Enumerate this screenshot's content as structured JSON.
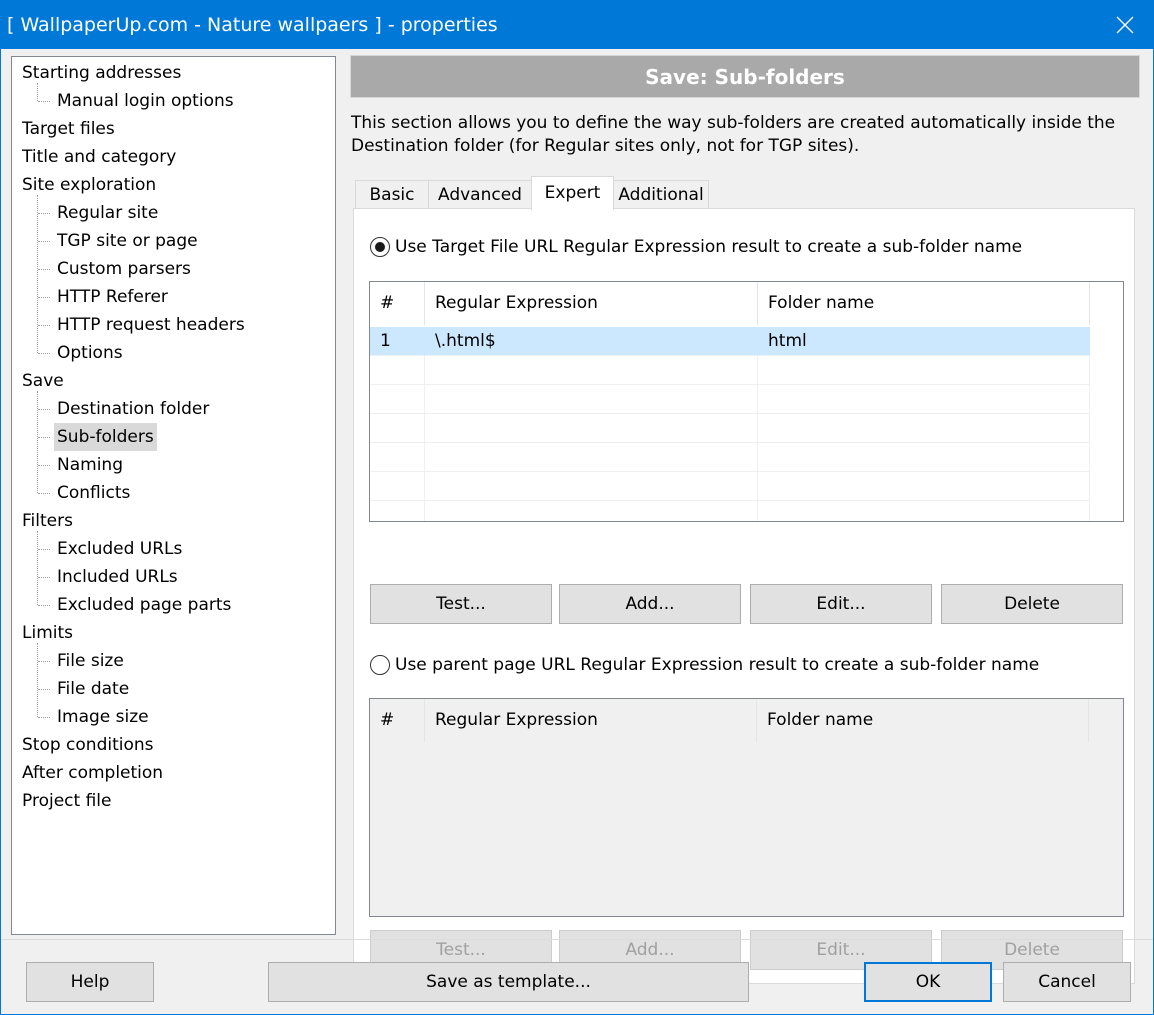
{
  "window": {
    "title": "[ WallpaperUp.com - Nature wallpaers ] - properties"
  },
  "tree": [
    {
      "label": "Starting addresses",
      "level": 0
    },
    {
      "label": "Manual login options",
      "level": 1
    },
    {
      "label": "Target files",
      "level": 0
    },
    {
      "label": "Title and category",
      "level": 0
    },
    {
      "label": "Site exploration",
      "level": 0
    },
    {
      "label": "Regular site",
      "level": 1
    },
    {
      "label": "TGP site or page",
      "level": 1
    },
    {
      "label": "Custom parsers",
      "level": 1
    },
    {
      "label": "HTTP Referer",
      "level": 1
    },
    {
      "label": "HTTP request headers",
      "level": 1
    },
    {
      "label": "Options",
      "level": 1
    },
    {
      "label": "Save",
      "level": 0
    },
    {
      "label": "Destination folder",
      "level": 1
    },
    {
      "label": "Sub-folders",
      "level": 1,
      "selected": true
    },
    {
      "label": "Naming",
      "level": 1
    },
    {
      "label": "Conflicts",
      "level": 1
    },
    {
      "label": "Filters",
      "level": 0
    },
    {
      "label": "Excluded URLs",
      "level": 1
    },
    {
      "label": "Included URLs",
      "level": 1
    },
    {
      "label": "Excluded page parts",
      "level": 1
    },
    {
      "label": "Limits",
      "level": 0
    },
    {
      "label": "File size",
      "level": 1
    },
    {
      "label": "File date",
      "level": 1
    },
    {
      "label": "Image size",
      "level": 1
    },
    {
      "label": "Stop conditions",
      "level": 0
    },
    {
      "label": "After completion",
      "level": 0
    },
    {
      "label": "Project file",
      "level": 0
    }
  ],
  "section": {
    "header": "Save: Sub-folders",
    "description": "This section allows you to define the way sub-folders are created automatically inside the Destination folder (for Regular sites only, not for TGP sites)."
  },
  "tabs": [
    "Basic",
    "Advanced",
    "Expert",
    "Additional"
  ],
  "active_tab": "Expert",
  "target_option": {
    "label": "Use Target File URL Regular Expression result to create a sub-folder name",
    "checked": true,
    "columns": [
      "#",
      "Regular Expression",
      "Folder name"
    ],
    "rows": [
      {
        "num": "1",
        "regex": "\\.html$",
        "folder": "html"
      }
    ],
    "buttons": {
      "test": "Test...",
      "add": "Add...",
      "edit": "Edit...",
      "delete": "Delete"
    }
  },
  "parent_option": {
    "label": "Use parent page URL Regular Expression result to create a sub-folder name",
    "checked": false,
    "columns": [
      "#",
      "Regular Expression",
      "Folder name"
    ],
    "rows": [],
    "buttons": {
      "test": "Test...",
      "add": "Add...",
      "edit": "Edit...",
      "delete": "Delete"
    }
  },
  "footer": {
    "help": "Help",
    "save_template": "Save as template...",
    "ok": "OK",
    "cancel": "Cancel"
  },
  "icons": {
    "close": "close-icon"
  }
}
